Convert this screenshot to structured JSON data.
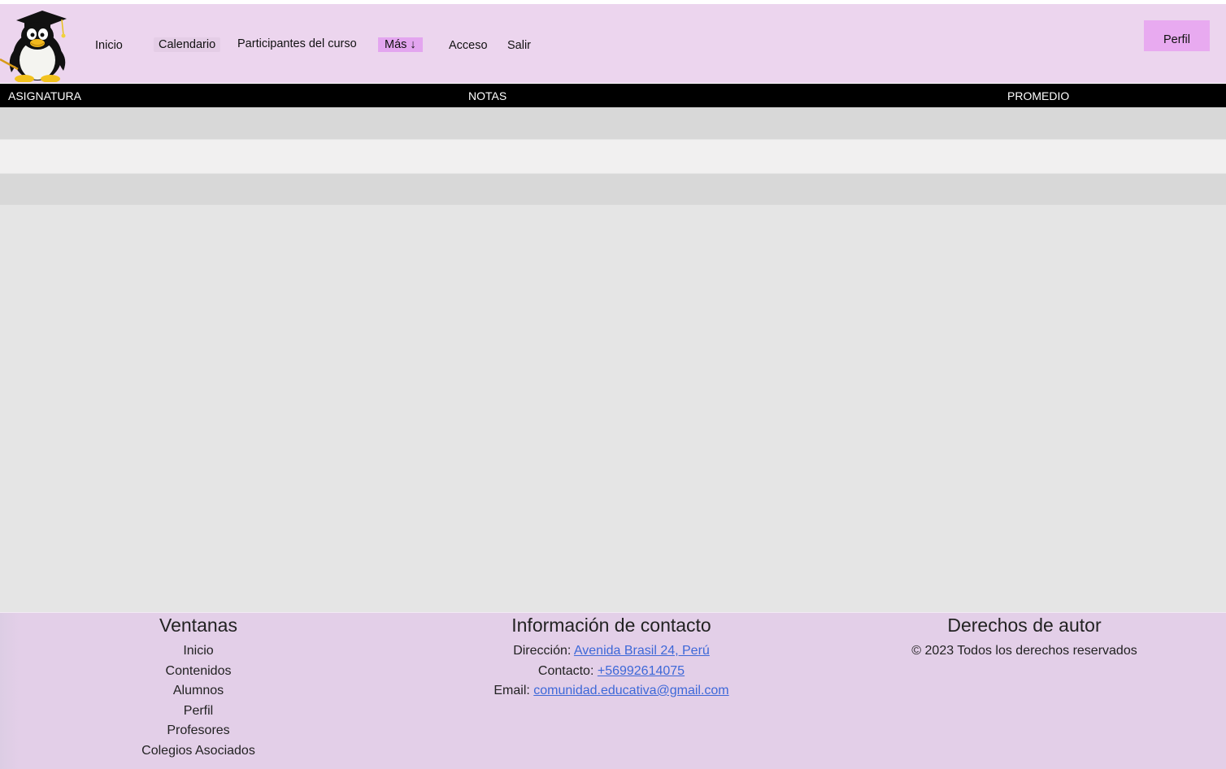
{
  "nav": {
    "items": [
      "Inicio",
      "Calendario",
      "Participantes del curso",
      "Más ↓",
      "Acceso",
      "Salir"
    ],
    "profile_button": "Perfil"
  },
  "table": {
    "headers": [
      "ASIGNATURA",
      "NOTAS",
      "PROMEDIO"
    ],
    "rows": [
      [],
      [],
      []
    ]
  },
  "footer": {
    "windows": {
      "title": "Ventanas",
      "links": [
        "Inicio",
        "Contenidos",
        "Alumnos",
        "Perfil",
        "Profesores",
        "Colegios Asociados"
      ]
    },
    "contact": {
      "title": "Información de contacto",
      "address_label": "Dirección: ",
      "address": "Avenida Brasil 24, Perú",
      "phone_label": "Contacto: ",
      "phone": "+56992614075",
      "email_label": "Email: ",
      "email": "comunidad.educativa@gmail.com"
    },
    "copyright": {
      "title": "Derechos de autor",
      "text": "© 2023 Todos los derechos reservados"
    }
  },
  "colors": {
    "navbar": "#ecd5ee",
    "accent": "#e8aaf0",
    "table_header": "#000000",
    "row_dark": "#d8d8d8",
    "row_light": "#f1f0f0",
    "footer": "#e3cfe8",
    "link": "#3d68d8"
  }
}
